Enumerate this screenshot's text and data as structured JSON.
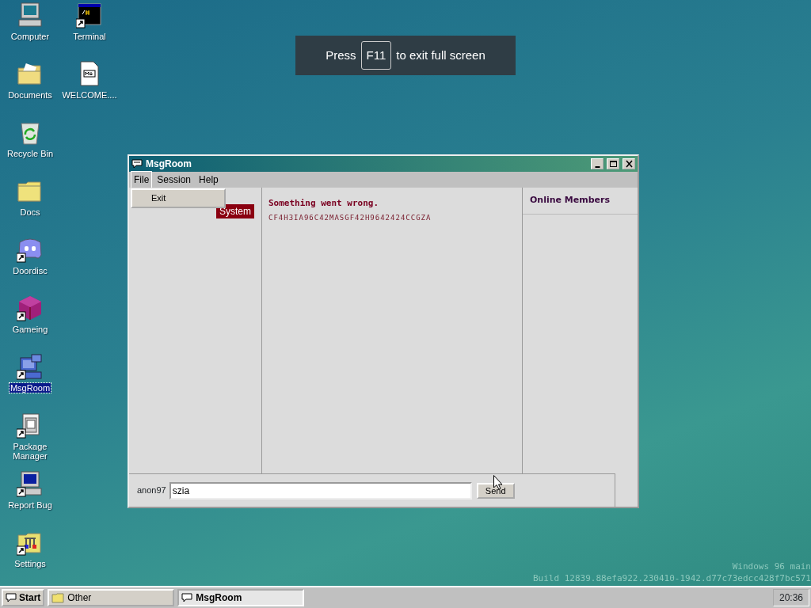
{
  "fullscreen_hint": {
    "before": "Press",
    "key": "F11",
    "after": "to exit full screen"
  },
  "desktop_icons": [
    {
      "label": "Computer",
      "shortcut": false,
      "selected": false
    },
    {
      "label": "Terminal",
      "shortcut": true,
      "selected": false
    },
    {
      "label": "Documents",
      "shortcut": false,
      "selected": false
    },
    {
      "label": "WELCOME....",
      "shortcut": false,
      "selected": false
    },
    {
      "label": "Recycle Bin",
      "shortcut": false,
      "selected": false
    },
    {
      "label": "Docs",
      "shortcut": false,
      "selected": false
    },
    {
      "label": "Doordisc",
      "shortcut": true,
      "selected": false
    },
    {
      "label": "Gameing",
      "shortcut": true,
      "selected": false
    },
    {
      "label": "MsgRoom",
      "shortcut": true,
      "selected": true
    },
    {
      "label": "Package Manager",
      "shortcut": true,
      "selected": false
    },
    {
      "label": "Report Bug",
      "shortcut": true,
      "selected": false
    },
    {
      "label": "Settings",
      "shortcut": true,
      "selected": false
    }
  ],
  "window": {
    "title": "MsgRoom",
    "menu": [
      {
        "label": "File",
        "selected": true
      },
      {
        "label": "Session",
        "selected": false
      },
      {
        "label": "Help",
        "selected": false
      }
    ],
    "open_menu": {
      "items": [
        "Exit"
      ]
    },
    "messages": [
      {
        "sender": "System",
        "title": "Something went wrong.",
        "body": "CF4H3IA96C42MASGF42H9642424CCGZA"
      }
    ],
    "members_heading": "Online Members",
    "username": "anon97",
    "input": {
      "value": "szia"
    },
    "send_button": "Send"
  },
  "watermark": {
    "line_1": "Windows 96 main",
    "line_2": "Build 12839.88efa922.230410-1942.d77c73edcc428f7bc571"
  },
  "taskbar": {
    "start": "Start",
    "tasks": [
      {
        "label": "Other",
        "selected": false
      },
      {
        "label": "MsgRoom",
        "selected": true
      }
    ],
    "clock": "20:36"
  }
}
